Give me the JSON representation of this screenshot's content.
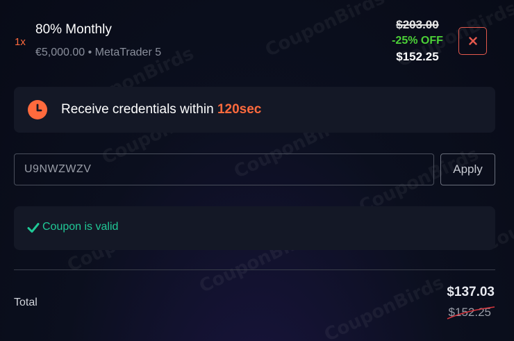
{
  "colors": {
    "accent_orange": "#ff6a3d",
    "discount_green": "#4cd137",
    "valid_green": "#20c997",
    "remove_red": "#e5594d",
    "strike_red": "#d9363e"
  },
  "watermark": "CouponBirds",
  "cart_item": {
    "quantity": "1x",
    "name": "80% Monthly",
    "subtitle": "€5,000.00 • MetaTrader 5",
    "price_original": "$203.00",
    "discount": "-25% OFF",
    "price_final": "$152.25",
    "remove_icon": "close-icon"
  },
  "timer": {
    "icon": "clock-icon",
    "text_prefix": "Receive credentials within ",
    "text_highlight": "120sec"
  },
  "coupon": {
    "code_value": "U9NWZWZV",
    "apply_label": "Apply",
    "valid_icon": "check-icon",
    "valid_message": "Coupon is valid"
  },
  "totals": {
    "label": "Total",
    "new_total": "$137.03",
    "old_total": "$152.25"
  }
}
